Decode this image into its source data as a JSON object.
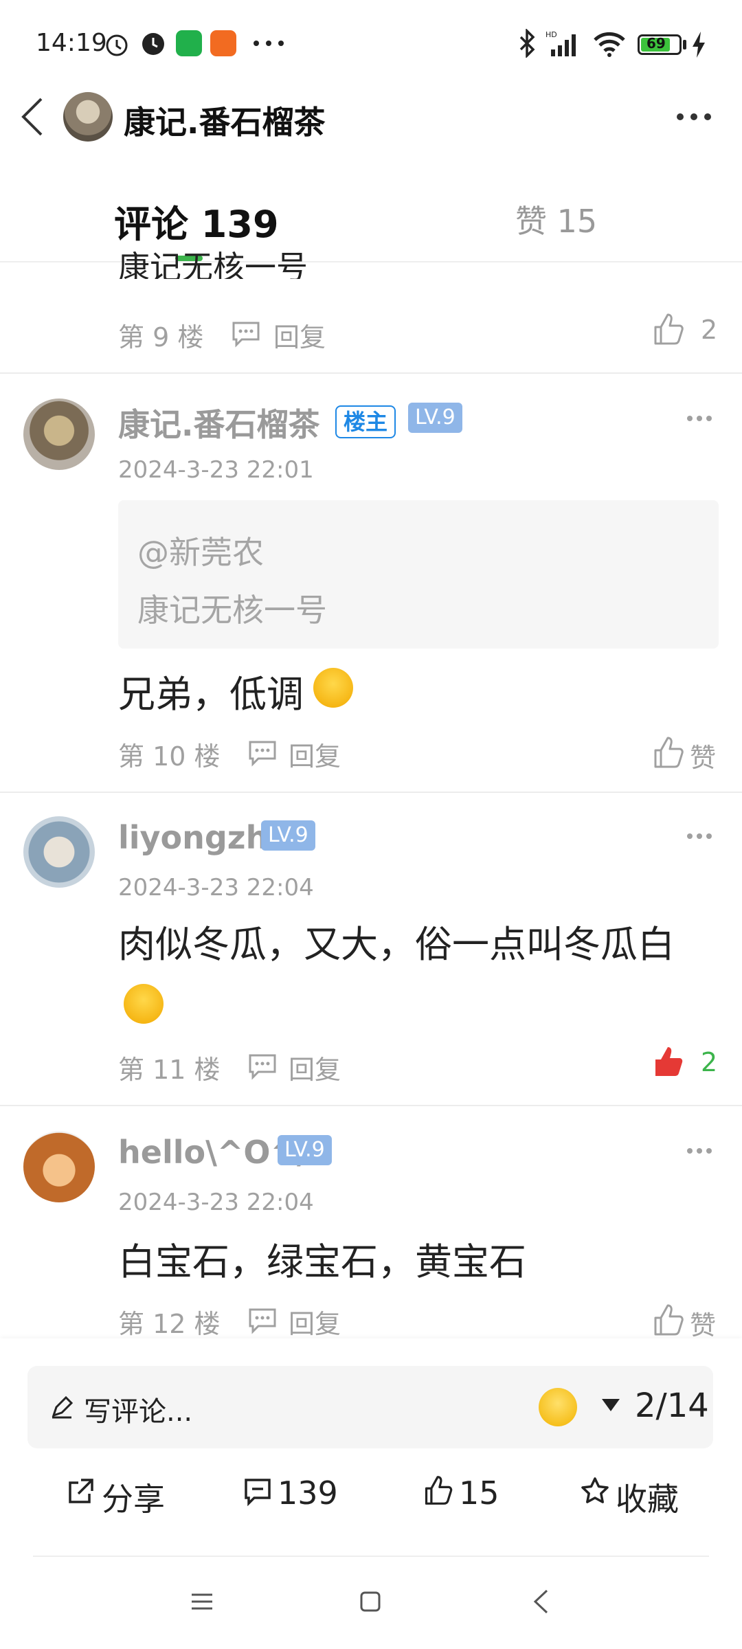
{
  "status_bar": {
    "time": "14:19",
    "battery": "69"
  },
  "header": {
    "title": "康记.番石榴茶"
  },
  "tabs": {
    "comments": "评论 139",
    "likes": "赞 15"
  },
  "partial_comment": {
    "text": "康记无核一号",
    "floor": "第 9 楼",
    "reply": "回复",
    "likes": "2"
  },
  "comments": [
    {
      "user": "康记.番石榴茶",
      "owner_badge": "楼主",
      "level": "LV.9",
      "date": "2024-3-23 22:01",
      "quote_user": "@新莞农",
      "quote_text": "康记无核一号",
      "text": "兄弟，低调",
      "floor": "第 10 楼",
      "reply": "回复",
      "likes": "赞"
    },
    {
      "user": "liyongzhi",
      "level": "LV.9",
      "date": "2024-3-23 22:04",
      "text": "肉似冬瓜，又大，俗一点叫冬瓜白",
      "floor": "第 11 楼",
      "reply": "回复",
      "likes": "2",
      "liked": true,
      "like_color": "#e53935"
    },
    {
      "user": "hello\\^O^/",
      "level": "LV.9",
      "date": "2024-3-23 22:04",
      "text": "白宝石，绿宝石，黄宝石",
      "floor": "第 12 楼",
      "reply": "回复",
      "likes": "赞"
    }
  ],
  "bottom": {
    "placeholder": "写评论...",
    "pager": "2/14",
    "share": "分享",
    "comment_count": "139",
    "like_count": "15",
    "favorite": "收藏"
  },
  "icons": [
    "back-icon",
    "more-icon",
    "reply-icon",
    "thumb-up-icon",
    "edit-icon",
    "share-icon",
    "comment-icon",
    "star-icon",
    "menu-icon",
    "home-icon",
    "nav-back-icon"
  ],
  "colors": {
    "accent_green": "#3cb44b",
    "level_badge": "#8fb6e8",
    "owner_badge": "#1e88e5",
    "liked_red": "#e53935"
  }
}
